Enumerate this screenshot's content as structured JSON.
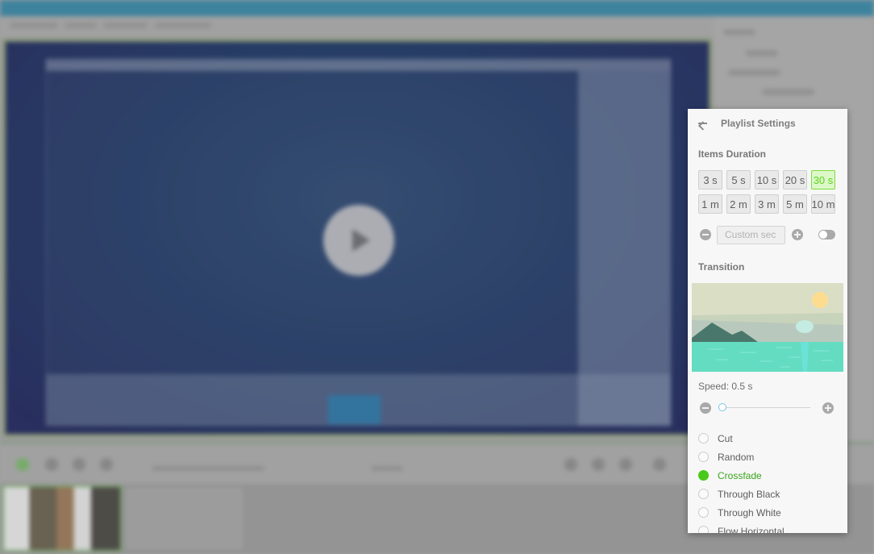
{
  "background_app": {
    "preview": {
      "play_icon": "play-icon"
    },
    "note": "blurred"
  },
  "settings_panel": {
    "title": "Playlist Settings",
    "back_icon": "arrow-left-icon",
    "items_duration": {
      "label": "Items Duration",
      "options": [
        {
          "label": "3 s",
          "selected": false
        },
        {
          "label": "5 s",
          "selected": false
        },
        {
          "label": "10 s",
          "selected": false
        },
        {
          "label": "20 s",
          "selected": false
        },
        {
          "label": "30 s",
          "selected": true
        },
        {
          "label": "1 m",
          "selected": false
        },
        {
          "label": "2 m",
          "selected": false
        },
        {
          "label": "3 m",
          "selected": false
        },
        {
          "label": "5 m",
          "selected": false
        },
        {
          "label": "10 m",
          "selected": false
        }
      ],
      "custom": {
        "placeholder": "Custom sec",
        "value": "",
        "decrement_icon": "minus-circle-icon",
        "increment_icon": "plus-circle-icon",
        "toggle_on": false
      }
    },
    "transition": {
      "label": "Transition",
      "preview_icon": "landscape-preview-image",
      "speed_label": "Speed: 0.5 s",
      "speed_value_seconds": 0.5,
      "speed_fraction": 0.0,
      "options": [
        {
          "label": "Cut",
          "selected": false
        },
        {
          "label": "Random",
          "selected": false
        },
        {
          "label": "Crossfade",
          "selected": true
        },
        {
          "label": "Through Black",
          "selected": false
        },
        {
          "label": "Through White",
          "selected": false
        },
        {
          "label": "Flow Horizontal",
          "selected": false
        }
      ]
    },
    "colors": {
      "accent_green": "#49c91a",
      "selected_button_bg": "#dcf8c8",
      "selected_button_border": "#7ddc3c",
      "slider_thumb": "#7cc4ec"
    }
  }
}
